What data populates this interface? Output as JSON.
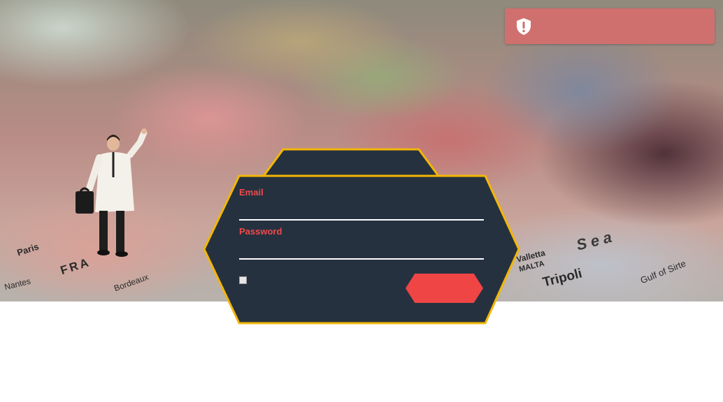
{
  "alert": {
    "icon": "shield-exclamation-icon",
    "message": "",
    "color": "#cf706f"
  },
  "login": {
    "email_label": "Email",
    "email_value": "",
    "password_label": "Password",
    "password_value": "",
    "remember_checked": false,
    "submit_label": "",
    "panel_color": "#263140",
    "border_color": "#f2b705",
    "accent_color": "#ee4a4a"
  },
  "map_labels": {
    "paris": "Paris",
    "fr": "FRA",
    "nantes": "Nantes",
    "bordeaux": "Bordeaux",
    "sea": "Sea",
    "tripoli": "Tripoli",
    "valletta": "Valletta",
    "malta": "MALTA",
    "gulf": "Gulf of Sirte"
  }
}
